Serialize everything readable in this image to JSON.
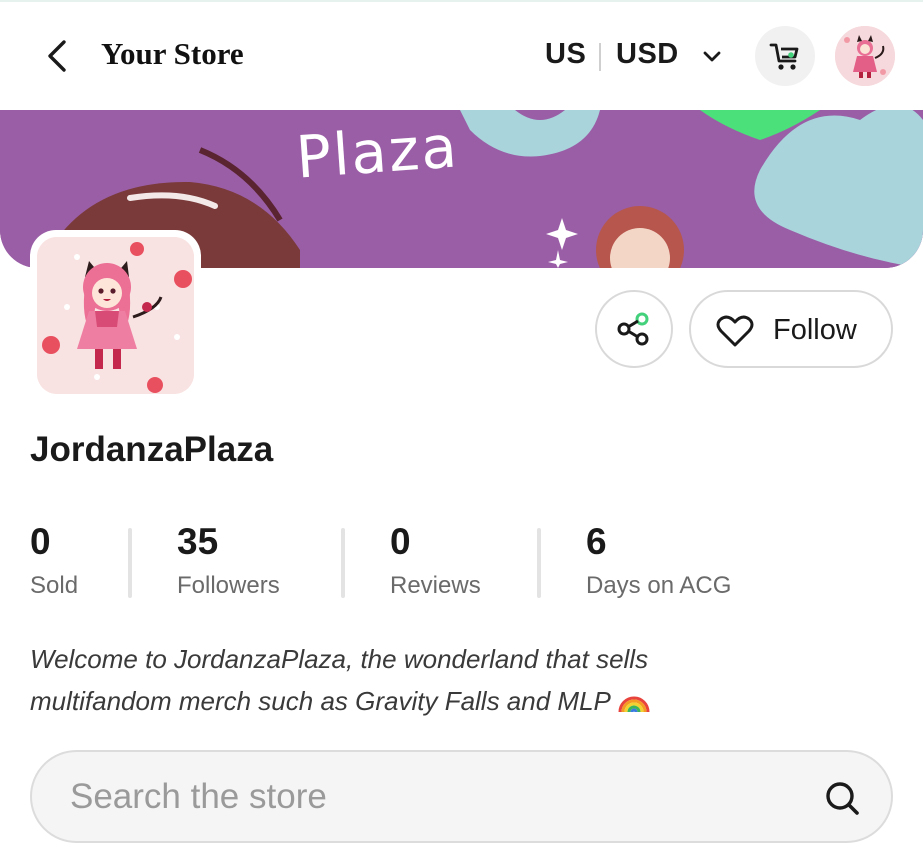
{
  "header": {
    "title": "Your Store",
    "region": "US",
    "currency": "USD",
    "icons": [
      "chevron-left-icon",
      "chevron-down-icon",
      "cart-icon",
      "avatar"
    ]
  },
  "banner": {
    "text": "Plaza"
  },
  "actions": {
    "follow_label": "Follow",
    "icons": [
      "share-icon",
      "heart-icon"
    ]
  },
  "store": {
    "name": "JordanzaPlaza",
    "stats": [
      {
        "value": "0",
        "label": "Sold"
      },
      {
        "value": "35",
        "label": "Followers"
      },
      {
        "value": "0",
        "label": "Reviews"
      },
      {
        "value": "6",
        "label": "Days on ACG"
      }
    ],
    "description": "Welcome to JordanzaPlaza, the wonderland that sells multifandom merch such as Gravity Falls and MLP"
  },
  "search": {
    "placeholder": "Search the store",
    "value": ""
  },
  "colors": {
    "banner_bg": "#9a5ea6",
    "banner_accent_blue": "#a9d4dc",
    "banner_accent_green": "#4be07a",
    "share_accent": "#43d17c"
  }
}
